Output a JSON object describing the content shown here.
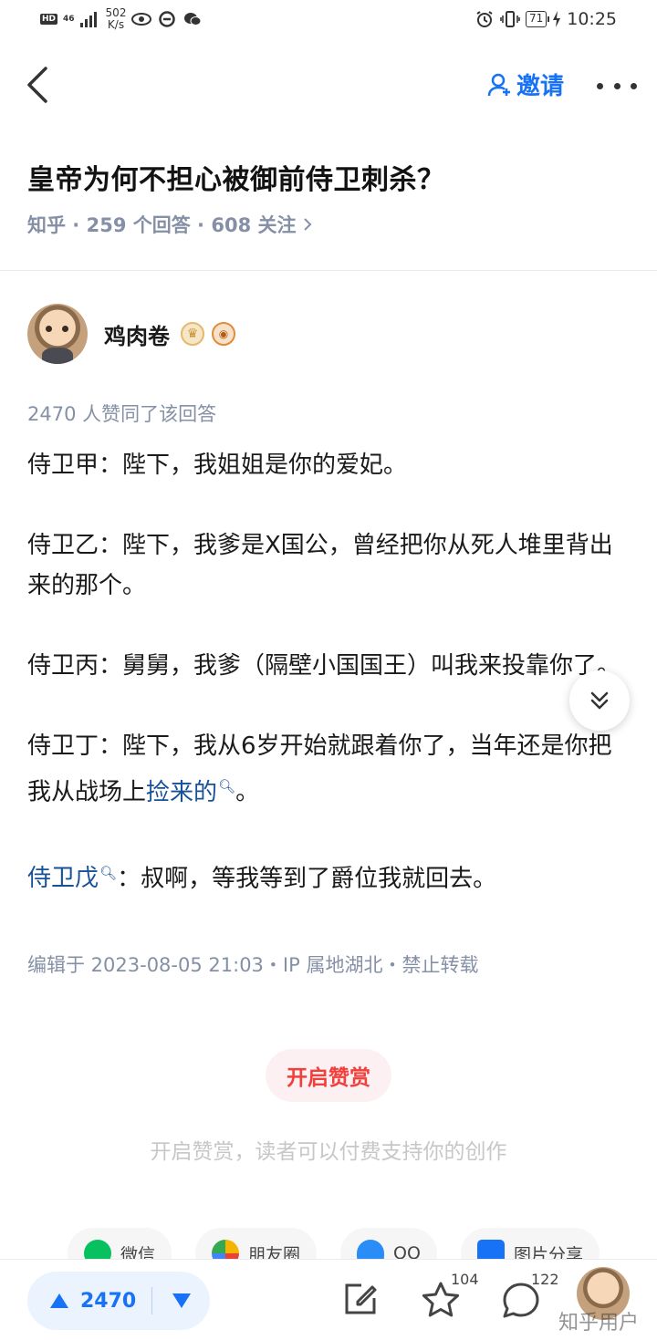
{
  "status_bar": {
    "hd": "HD",
    "signal": "46",
    "speed_value": "502",
    "speed_unit": "K/s",
    "battery": "71",
    "time": "10:25"
  },
  "nav": {
    "invite_label": "邀请"
  },
  "question": {
    "title": "皇帝为何不担心被御前侍卫刺杀？",
    "meta": "知乎 · 259 个回答 · 608 关注"
  },
  "author": {
    "name": "鸡肉卷"
  },
  "answer": {
    "vote_summary": "2470 人赞同了该回答",
    "p1": "侍卫甲：陛下，我姐姐是你的爱妃。",
    "p2": "侍卫乙：陛下，我爹是X国公，曾经把你从死人堆里背出来的那个。",
    "p3": "侍卫丙：舅舅，我爹（隔壁小国国王）叫我来投靠你了。",
    "p4_prefix": "侍卫丁：陛下，我从6岁开始就跟着你了，当年还是你把我从战场上",
    "p4_link": "捡来的",
    "p4_suffix": "。",
    "p5_link": "侍卫戊",
    "p5_suffix": "：叔啊，等我等到了爵位我就回去。",
    "edit_info": "编辑于 2023-08-05 21:03・IP 属地湖北・禁止转载"
  },
  "reward": {
    "button_label": "开启赞赏",
    "description": "开启赞赏，读者可以付费支持你的创作"
  },
  "share": [
    {
      "label": "微信",
      "icon": "wechat-icon",
      "color": "#07c160"
    },
    {
      "label": "朋友圈",
      "icon": "moments-icon",
      "color": "#f4b400"
    },
    {
      "label": "QQ",
      "icon": "qq-icon",
      "color": "#2a8cf6"
    },
    {
      "label": "图片分享",
      "icon": "image-share-icon",
      "color": "#1772f6"
    }
  ],
  "bottom_bar": {
    "vote_count": "2470",
    "favorite_count": "104",
    "comment_count": "122"
  },
  "watermark": "知乎用户",
  "colors": {
    "accent": "#1772f6",
    "link": "#175199",
    "meta": "#8590a6",
    "reward": "#f1403c"
  }
}
